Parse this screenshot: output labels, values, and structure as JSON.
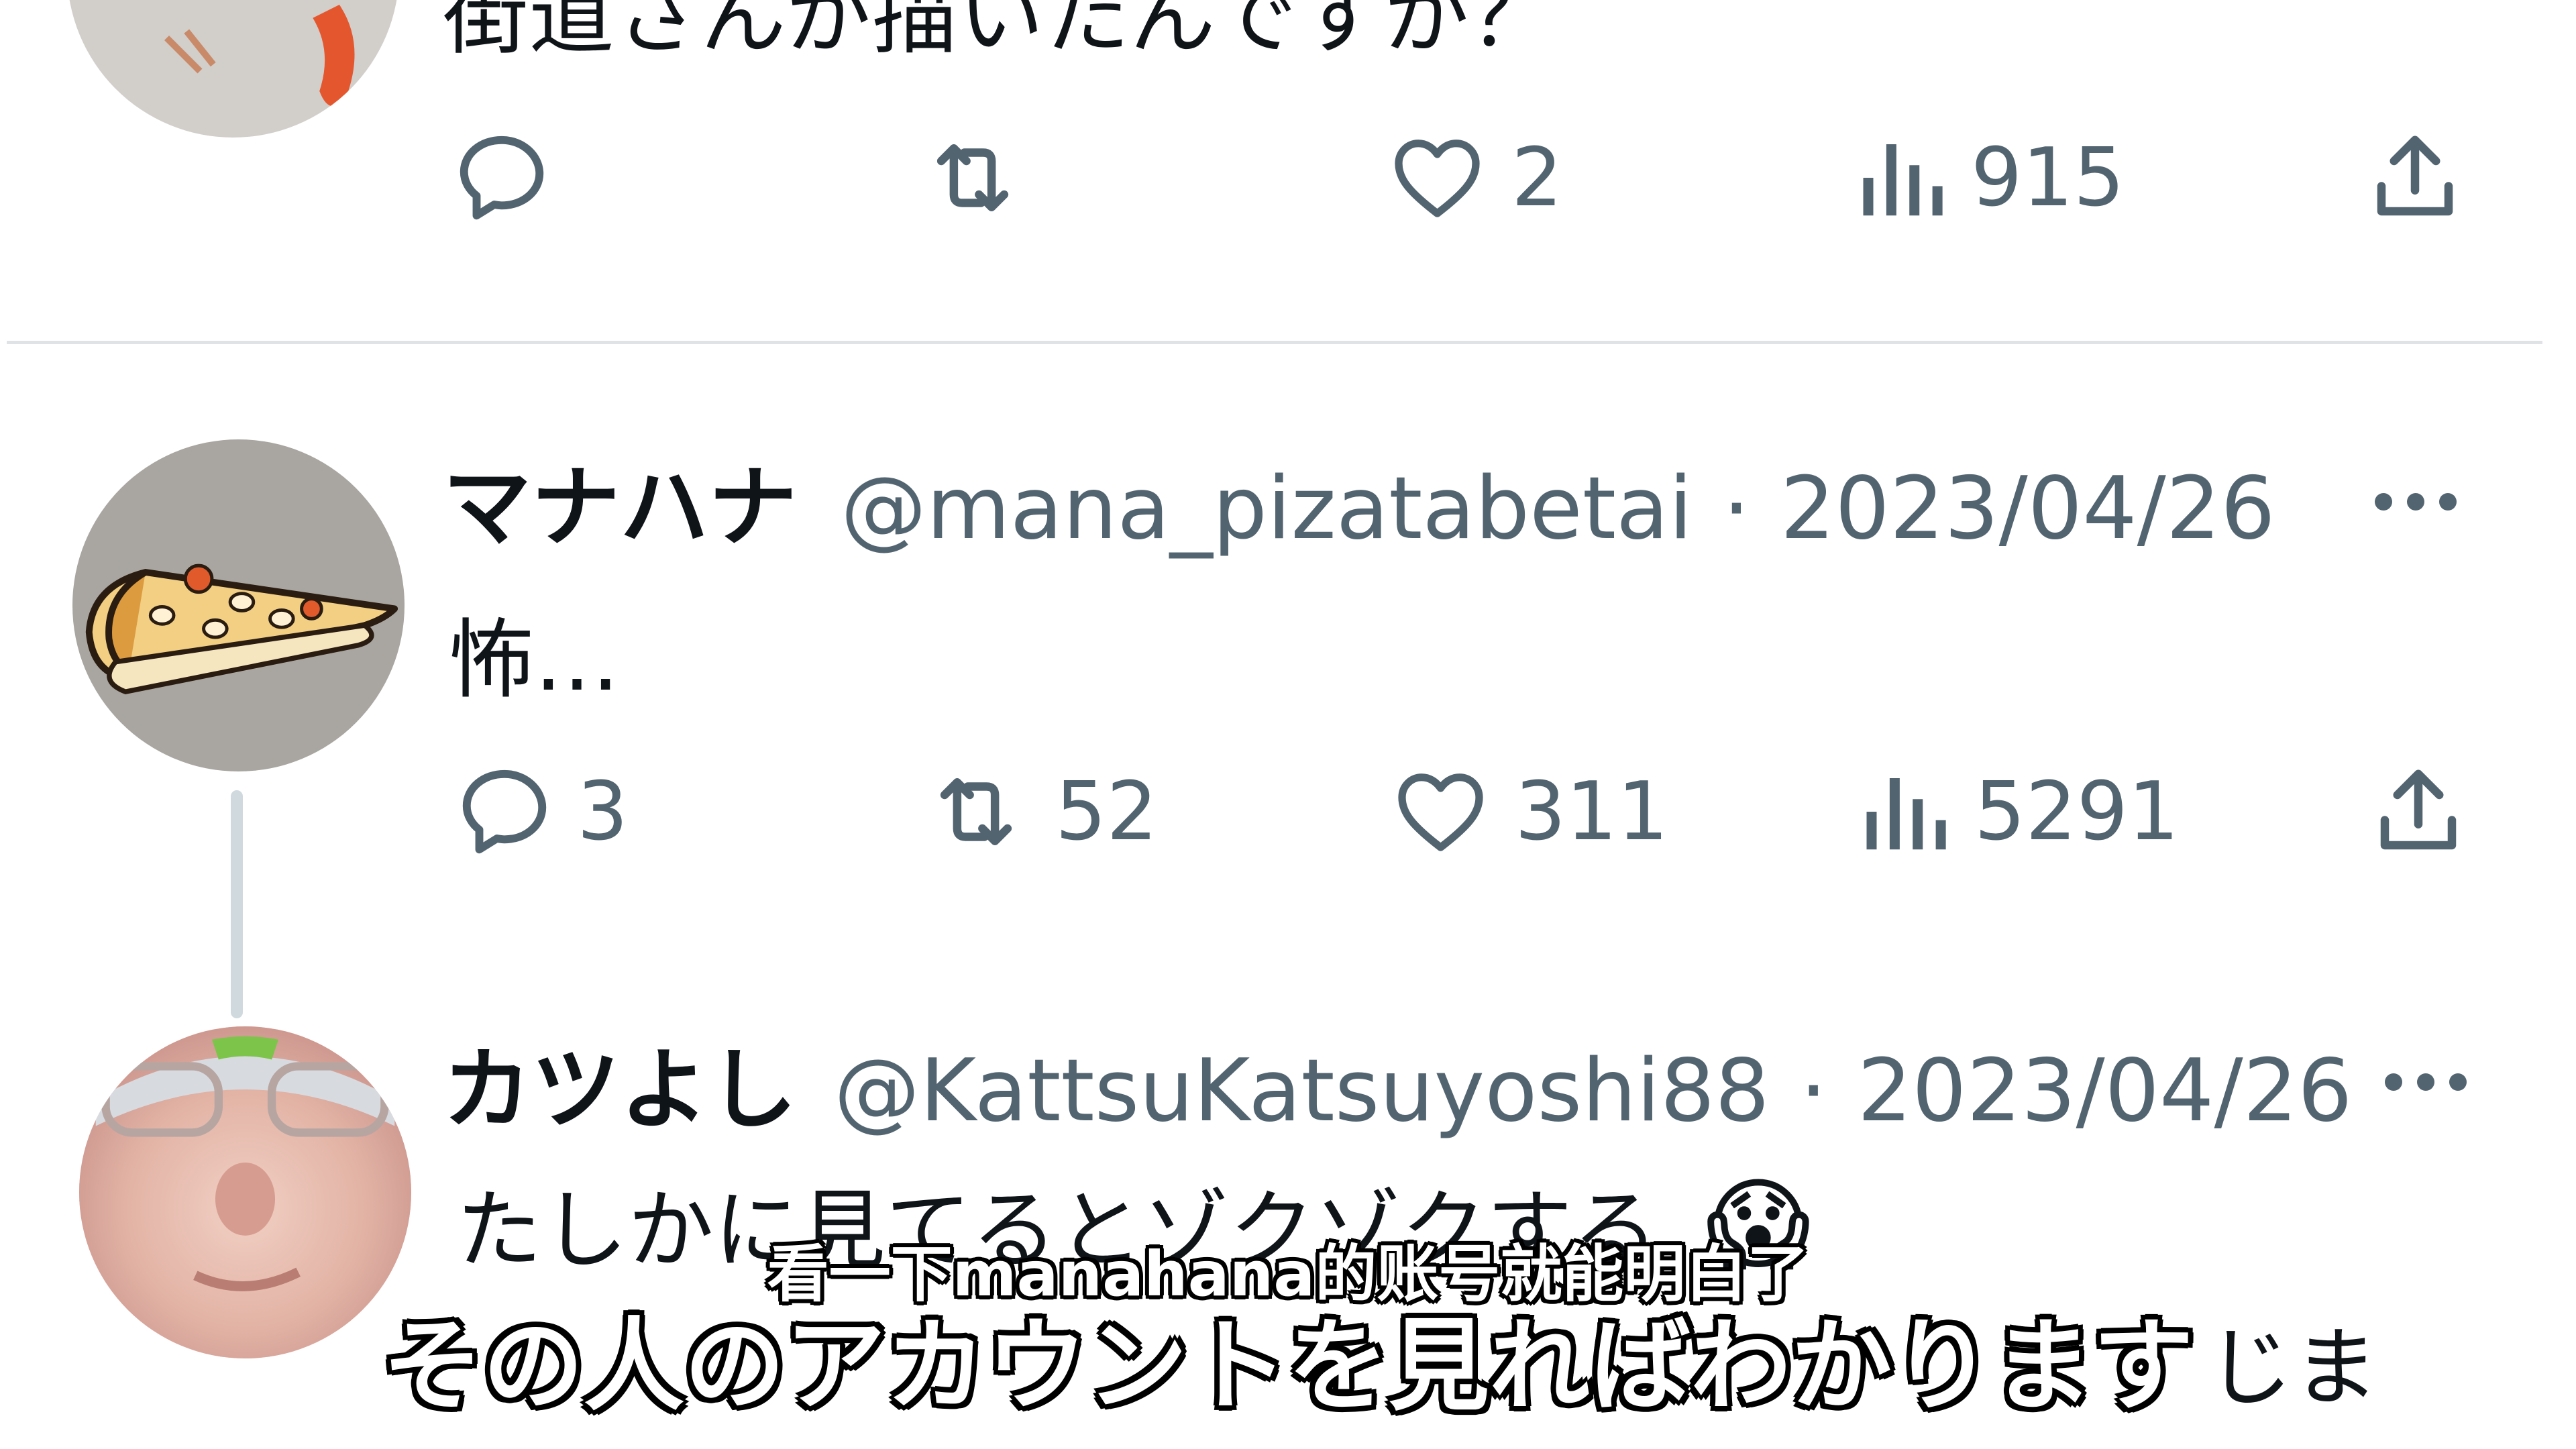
{
  "tweet_prev": {
    "text": "街道さんが描いたんですか？",
    "likes": "2",
    "views": "915"
  },
  "tweet_1": {
    "display_name": "マナハナ",
    "handle": "@mana_pizatabetai",
    "separator": "·",
    "date": "2023/04/26",
    "text": "怖…",
    "replies": "3",
    "retweets": "52",
    "likes": "311",
    "views": "5291"
  },
  "tweet_2": {
    "display_name": "カツよし",
    "handle": "@KattsuKatsuyoshi88",
    "separator": "·",
    "date": "2023/04/26",
    "text": "たしかに見てるとゾクゾクする",
    "emoji": "😱",
    "text_line2_tail": "じま"
  },
  "subtitles": {
    "chinese": "看一下manahana的账号就能明白了",
    "japanese": "その人のアカウントを見ればわかります"
  },
  "icons": [
    "reply-icon",
    "retweet-icon",
    "like-icon",
    "views-icon",
    "share-icon",
    "more-icon"
  ],
  "colors": {
    "text_primary": "#0f1419",
    "text_secondary": "#536471",
    "divider": "#dfe3e6",
    "thread_line": "#cfd9de"
  }
}
